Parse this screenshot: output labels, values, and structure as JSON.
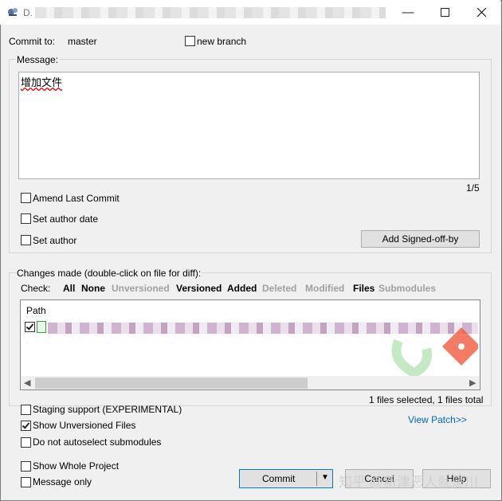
{
  "window": {
    "title": "D."
  },
  "commit_to": {
    "label": "Commit to:",
    "branch": "master",
    "new_branch_label": "new branch"
  },
  "message": {
    "label": "Message:",
    "text": "增加文件",
    "counter": "1/5"
  },
  "options": {
    "amend_last_commit": "Amend Last Commit",
    "set_author_date": "Set author date",
    "set_author": "Set author",
    "add_signed_off_by": "Add Signed-off-by"
  },
  "changes": {
    "label": "Changes made (double-click on file for diff):",
    "check_label": "Check:",
    "filters": [
      {
        "label": "All",
        "enabled": true
      },
      {
        "label": "None",
        "enabled": true
      },
      {
        "label": "Unversioned",
        "enabled": false
      },
      {
        "label": "Versioned",
        "enabled": true
      },
      {
        "label": "Added",
        "enabled": true
      },
      {
        "label": "Deleted",
        "enabled": false
      },
      {
        "label": "Modified",
        "enabled": false
      },
      {
        "label": "Files",
        "enabled": true
      },
      {
        "label": "Submodules",
        "enabled": false
      }
    ],
    "column_path": "Path",
    "summary": "1 files selected, 1 files total",
    "view_patch": "View Patch>>"
  },
  "bottom_options": {
    "staging_support": "Staging support (EXPERIMENTAL)",
    "show_unversioned": "Show Unversioned Files",
    "no_autoselect": "Do not autoselect submodules",
    "show_whole_project": "Show Whole Project",
    "message_only": "Message only"
  },
  "buttons": {
    "commit": "Commit",
    "cancel": "Cancel",
    "help": "Help"
  },
  "watermark": "知乎 @新津恶人就是川",
  "colors": {
    "link": "#0066cc",
    "disabled": "#a0a0a0"
  }
}
